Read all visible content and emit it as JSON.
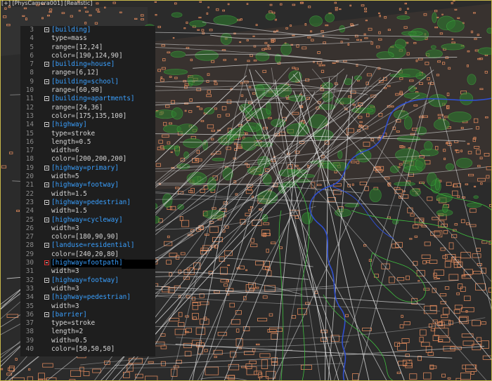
{
  "viewport": {
    "label": "[+] [PhysCamera001] [Realistic]",
    "frame_color": "#c8b84a"
  },
  "colors": {
    "section": "#3aa0ff",
    "text": "#d4d4d4",
    "line_number": "#8a8a8a",
    "panel_bg": "#1e1e1e",
    "scene_bg": "#2b2b2b",
    "roads": "#e8e8e8",
    "buildings": "#d9865a",
    "vegetation": "#3fbf3f",
    "water": "#3050d0"
  },
  "editor": {
    "active_line": 30,
    "lines": [
      {
        "n": "3",
        "text": "[building]",
        "section": true
      },
      {
        "n": "4",
        "text": "type=mass",
        "section": false
      },
      {
        "n": "5",
        "text": "range=[12,24]",
        "section": false
      },
      {
        "n": "6",
        "text": "color=[190,124,90]",
        "section": false
      },
      {
        "n": "7",
        "text": "[building=house]",
        "section": true
      },
      {
        "n": "8",
        "text": "range=[6,12]",
        "section": false
      },
      {
        "n": "9",
        "text": "[building=school]",
        "section": true
      },
      {
        "n": "10",
        "text": "range=[60,90]",
        "section": false
      },
      {
        "n": "11",
        "text": "[building=apartments]",
        "section": true
      },
      {
        "n": "12",
        "text": "range=[24,36]",
        "section": false
      },
      {
        "n": "13",
        "text": "color=[175,135,100]",
        "section": false
      },
      {
        "n": "14",
        "text": "[highway]",
        "section": true
      },
      {
        "n": "15",
        "text": "type=stroke",
        "section": false
      },
      {
        "n": "16",
        "text": "length=0.5",
        "section": false
      },
      {
        "n": "17",
        "text": "width=6",
        "section": false
      },
      {
        "n": "18",
        "text": "color=[200,200,200]",
        "section": false
      },
      {
        "n": "19",
        "text": "[highway=primary]",
        "section": true
      },
      {
        "n": "20",
        "text": "width=5",
        "section": false
      },
      {
        "n": "21",
        "text": "[highway=footway]",
        "section": true
      },
      {
        "n": "22",
        "text": "width=1.5",
        "section": false
      },
      {
        "n": "23",
        "text": "[highway=pedestrian]",
        "section": true
      },
      {
        "n": "24",
        "text": "width=1.5",
        "section": false
      },
      {
        "n": "25",
        "text": "[highway=cycleway]",
        "section": true
      },
      {
        "n": "26",
        "text": "width=3",
        "section": false
      },
      {
        "n": "27",
        "text": "color=[180,90,90]",
        "section": false
      },
      {
        "n": "28",
        "text": "[landuse=residential]",
        "section": true
      },
      {
        "n": "29",
        "text": "color=[240,20,80]",
        "section": false
      },
      {
        "n": "30",
        "text": "[highway=footpath]",
        "section": true
      },
      {
        "n": "31",
        "text": "width=3",
        "section": false
      },
      {
        "n": "32",
        "text": "[highway=footway]",
        "section": true
      },
      {
        "n": "33",
        "text": "width=3",
        "section": false
      },
      {
        "n": "34",
        "text": "[highway=pedestrian]",
        "section": true
      },
      {
        "n": "35",
        "text": "width=3",
        "section": false
      },
      {
        "n": "36",
        "text": "[barrier]",
        "section": true
      },
      {
        "n": "37",
        "text": "type=stroke",
        "section": false
      },
      {
        "n": "38",
        "text": "length=2",
        "section": false
      },
      {
        "n": "39",
        "text": "width=0.5",
        "section": false
      },
      {
        "n": "40",
        "text": "color=[50,50,50]",
        "section": false
      }
    ]
  }
}
